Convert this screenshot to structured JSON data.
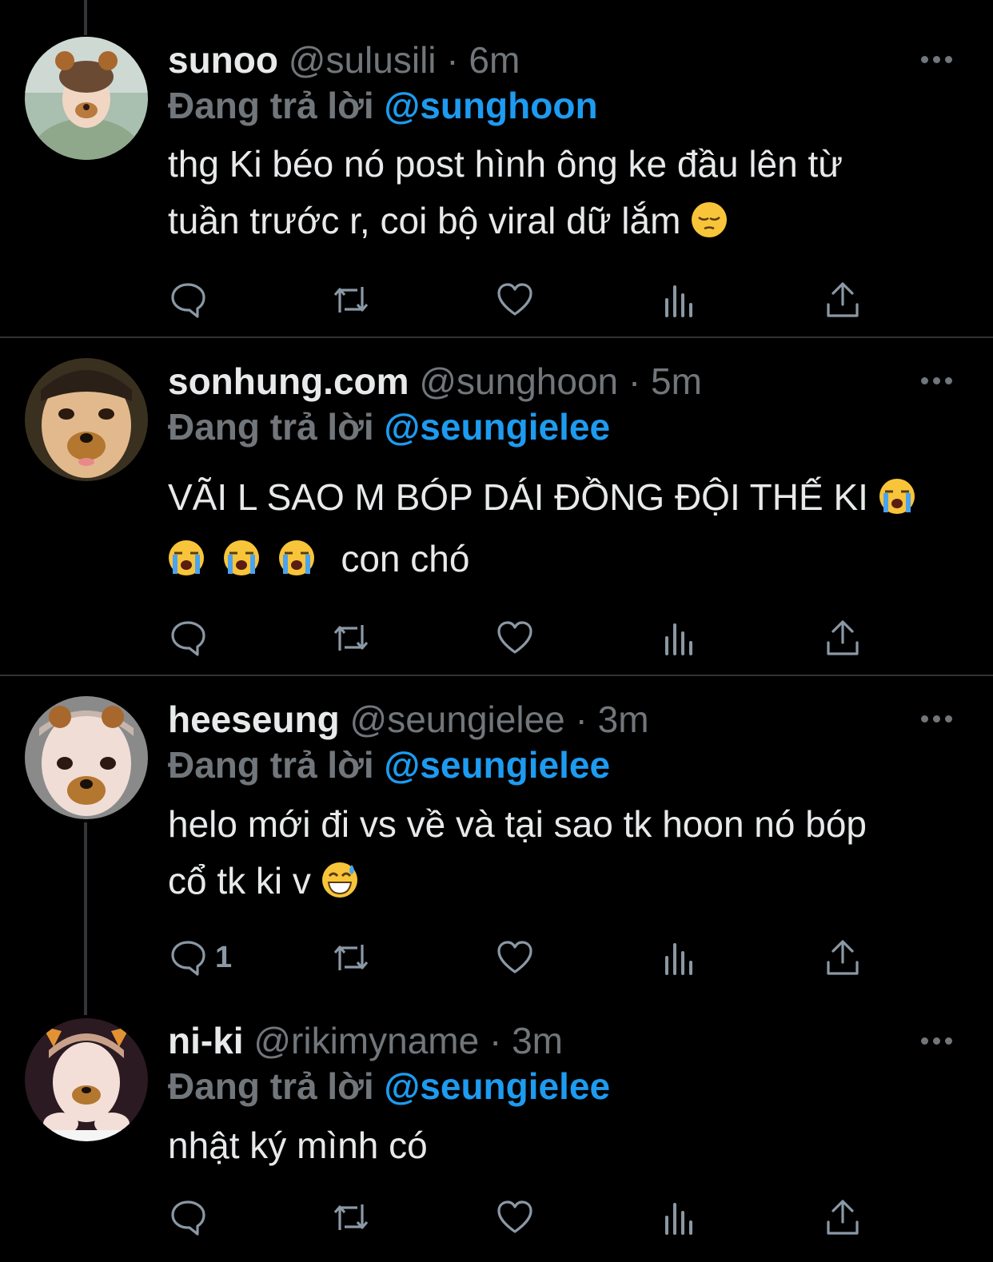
{
  "tweets": [
    {
      "name": "sunoo",
      "handle": "@sulusili",
      "time": "· 6m",
      "reply_prefix": "Đang trả lời",
      "reply_to": "@sunghoon",
      "text_lines": [
        "thg Ki béo nó post hình ông ke đầu lên từ",
        "tuần trước r, coi bộ viral dữ lắm"
      ],
      "emoji": "pensive-face",
      "reply_count": ""
    },
    {
      "name": "sonhung.com",
      "handle": "@sunghoon",
      "time": "· 5m",
      "reply_prefix": "Đang trả lời",
      "reply_to": "@seungielee",
      "text_lines": [
        "VÃI L SAO M BÓP DÁI ĐỒNG ĐỘI THẾ KI",
        "con chó"
      ],
      "emoji": "loudly-crying-face",
      "reply_count": ""
    },
    {
      "name": "heeseung",
      "handle": "@seungielee",
      "time": "· 3m",
      "reply_prefix": "Đang trả lời",
      "reply_to": "@seungielee",
      "text_lines": [
        "helo mới đi vs về và tại sao tk hoon nó bóp",
        "cổ tk ki v"
      ],
      "emoji": "grinning-face-with-sweat",
      "reply_count": "1"
    },
    {
      "name": "ni-ki",
      "handle": "@rikimyname",
      "time": "· 3m",
      "reply_prefix": "Đang trả lời",
      "reply_to": "@seungielee",
      "text_lines": [
        "nhật ký mình có"
      ],
      "emoji": "",
      "reply_count": ""
    }
  ],
  "icons": {
    "reply": "reply-icon",
    "retweet": "retweet-icon",
    "like": "heart-icon",
    "views": "views-icon",
    "share": "share-icon",
    "more": "more-icon"
  },
  "colors": {
    "background": "#000000",
    "text": "#e7e9ea",
    "muted": "#71767b",
    "accent": "#1d9bf0"
  }
}
